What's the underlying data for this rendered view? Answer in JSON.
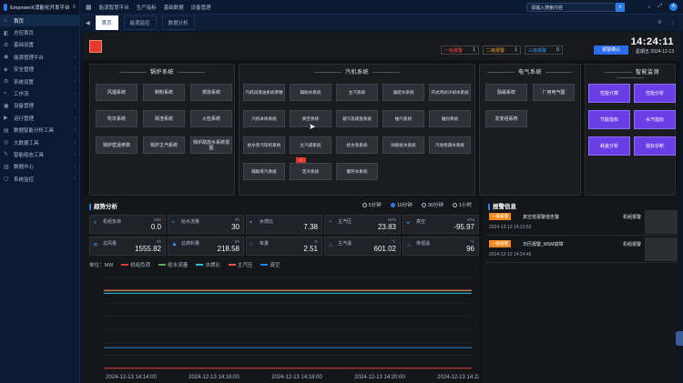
{
  "app": {
    "brand": "EmpowerX消能化开发平台",
    "menu_icon": "menu-icon"
  },
  "sidebar": {
    "items": [
      {
        "label": "首页",
        "icon": "home-icon",
        "active": true
      },
      {
        "label": "总控首页",
        "icon": "dashboard-icon"
      },
      {
        "label": "基础设置",
        "icon": "settings-icon"
      },
      {
        "label": "能源管理平台",
        "icon": "energy-icon",
        "chevron": true
      },
      {
        "label": "安全管理",
        "icon": "shield-icon",
        "chevron": true
      },
      {
        "label": "系统设置",
        "icon": "gear-icon",
        "chevron": true
      },
      {
        "label": "工作流",
        "icon": "flow-icon",
        "chevron": true
      },
      {
        "label": "设备管理",
        "icon": "device-icon",
        "chevron": true
      },
      {
        "label": "运行管理",
        "icon": "run-icon",
        "chevron": true
      },
      {
        "label": "数据智能分析工具",
        "icon": "chart-icon",
        "chevron": true
      },
      {
        "label": "大数据工具",
        "icon": "data-icon",
        "chevron": true
      },
      {
        "label": "智能组态工具",
        "icon": "tool-icon",
        "chevron": true
      },
      {
        "label": "数据中心",
        "icon": "database-icon",
        "chevron": true
      },
      {
        "label": "系统监控",
        "icon": "monitor-icon",
        "chevron": true
      }
    ]
  },
  "topbar": {
    "nav": [
      "能源智慧平台",
      "生产指标",
      "基础数据",
      "设备管理"
    ],
    "search_placeholder": "请输入搜索内容",
    "icons": [
      "bell-icon",
      "expand-icon",
      "user-icon"
    ],
    "avatar_text": "A"
  },
  "tabs": [
    {
      "label": "首页",
      "active": true
    },
    {
      "label": "能源监控"
    },
    {
      "label": "数据分析"
    }
  ],
  "header": {
    "alarm_levels": [
      {
        "label": "一级报警",
        "count": "1"
      },
      {
        "label": "二级报警",
        "count": "1"
      },
      {
        "label": "三级报警",
        "count": "0"
      }
    ],
    "confirm_label": "报警确认",
    "time": "14:24:11",
    "date": "星期五 2024-12-13"
  },
  "boiler": {
    "title": "锅炉系统",
    "items": [
      "风烟系统",
      "制粉系统",
      "燃烧系统",
      "吹灰系统",
      "除渣系统",
      "火检系统",
      "锅炉壁温参数",
      "锅炉主汽系统",
      "锅炉疏放水系统视图"
    ]
  },
  "turbine": {
    "title": "汽机系统",
    "items": [
      "汽机润滑油系统参数",
      "辅助水系统",
      "主汽系统",
      "凝结水系统",
      "开式闭式冷却水系统",
      "汽机本体系统",
      "真空系统",
      "凝汽及疏放系统",
      "抽汽系统",
      "轴封系统",
      "给水泵汽轮机系统",
      "主汽疏系统",
      "给水泵系统",
      "除氧给水系统",
      "汽动泵疏水系统",
      "辅助蒸汽系统",
      "定冷系统",
      "循环水系统"
    ],
    "vacuum_badge": "1"
  },
  "electrical": {
    "title": "电气系统",
    "items": [
      "励磁系统",
      "厂用电气图",
      "发变组系统"
    ]
  },
  "smart": {
    "title": "智能监测",
    "items": [
      "性能计算",
      "性能分析",
      "节能指标",
      "水汽指标",
      "耗差分析",
      "指标诊断"
    ]
  },
  "trend": {
    "title": "趋势分析",
    "radios": [
      {
        "label": "5分钟",
        "on": false
      },
      {
        "label": "10分钟",
        "on": true
      },
      {
        "label": "30分钟",
        "on": false
      },
      {
        "label": "1小时",
        "on": false
      }
    ],
    "metrics": [
      {
        "label": "机组负荷",
        "unit": "MW",
        "value": "0.0",
        "icon": "power-icon"
      },
      {
        "label": "给水流量",
        "unit": "t/h",
        "value": "30",
        "icon": "flow-icon"
      },
      {
        "label": "水燃比",
        "unit": "",
        "value": "7.38",
        "icon": "ratio-icon"
      },
      {
        "label": "主汽压",
        "unit": "MPa",
        "value": "23.83",
        "icon": "pressure-icon"
      },
      {
        "label": "真空",
        "unit": "kPa",
        "value": "-95.97",
        "icon": "vacuum-icon"
      },
      {
        "label": "总风量",
        "unit": "t/h",
        "value": "1555.82",
        "icon": "wind-icon"
      },
      {
        "label": "总燃料量",
        "unit": "t/h",
        "value": "218.58",
        "icon": "fuel-icon"
      },
      {
        "label": "氧量",
        "unit": "%",
        "value": "2.51",
        "icon": "oxygen-icon"
      },
      {
        "label": "主汽温",
        "unit": "℃",
        "value": "601.02",
        "icon": "temp-icon"
      },
      {
        "label": "排烟温",
        "unit": "℃",
        "value": "96",
        "icon": "temp-icon"
      }
    ]
  },
  "chart_data": {
    "type": "line",
    "ylabel": "单位：MW",
    "x": [
      "2024-12-13 14:14:00",
      "2024-12-13 14:16:00",
      "2024-12-13 14:18:00",
      "2024-12-13 14:20:00",
      "2024-12-13 14:22:00"
    ],
    "series": [
      {
        "name": "机组负荷",
        "color": "#e53935",
        "values": [
          2,
          2,
          2,
          2,
          2
        ]
      },
      {
        "name": "给水流量",
        "color": "#4caf50",
        "values": [
          598,
          598,
          598,
          598,
          598
        ]
      },
      {
        "name": "水燃比",
        "color": "#26c6da",
        "values": [
          578,
          578,
          578,
          578,
          578
        ]
      },
      {
        "name": "主汽压",
        "color": "#ef5350",
        "values": [
          602,
          602,
          602,
          602,
          602
        ]
      },
      {
        "name": "真空",
        "color": "#1e88e5",
        "values": [
          160,
          160,
          160,
          160,
          160
        ]
      }
    ],
    "ylim": [
      0,
      700
    ]
  },
  "alarms": {
    "title": "报警信息",
    "items": [
      {
        "level": "一级报警",
        "text": "真空低报警值告警",
        "group": "机组报警",
        "time": "2024-12-13 14:23:52"
      },
      {
        "level": "一级报警",
        "text": "日历报警_MSM故障",
        "group": "机组报警",
        "time": "2024-12-13 14:24:45"
      }
    ]
  }
}
